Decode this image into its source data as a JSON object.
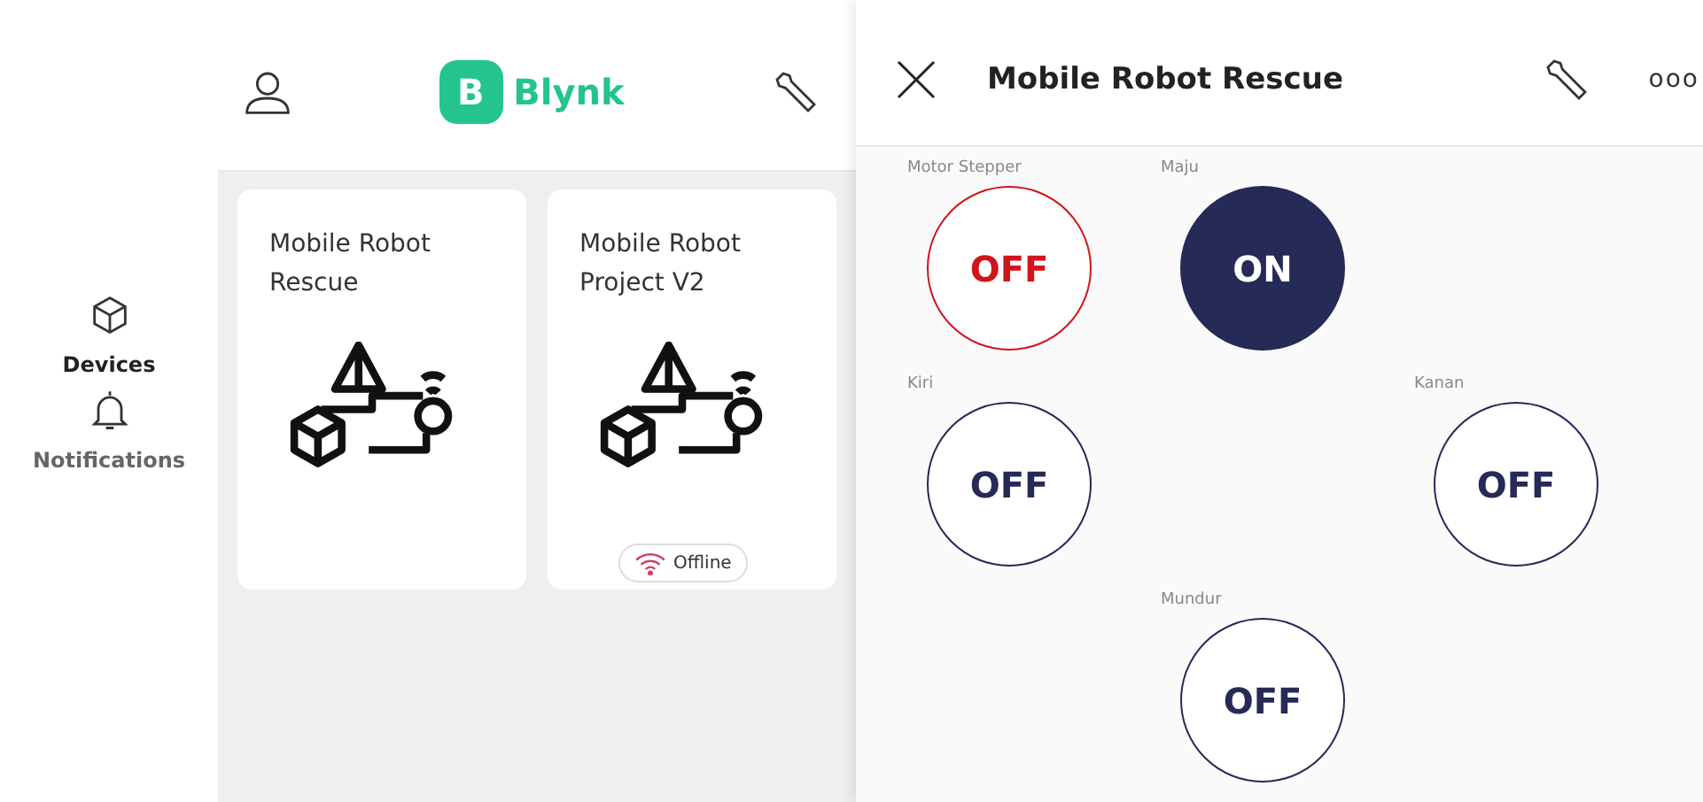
{
  "sidebar": {
    "items": [
      {
        "label": "Devices",
        "selected": true
      },
      {
        "label": "Notifications",
        "selected": false
      }
    ]
  },
  "main": {
    "logo": {
      "mark": "B",
      "name": "Blynk"
    },
    "devices": [
      {
        "name": "Mobile Robot Rescue"
      },
      {
        "name": "Mobile Robot Project V2",
        "status": "Offline"
      }
    ]
  },
  "detail": {
    "title": "Mobile Robot Rescue",
    "more": "ooo",
    "widgets": [
      {
        "label": "Motor Stepper",
        "value": "OFF",
        "on": false,
        "color": "#d0141b"
      },
      {
        "label": "Maju",
        "value": "ON",
        "on": true,
        "color": "#262a57"
      },
      {
        "label": "Kiri",
        "value": "OFF",
        "on": false,
        "color": "#262a57"
      },
      {
        "label": "Kanan",
        "value": "OFF",
        "on": false,
        "color": "#262a57"
      },
      {
        "label": "Mundur",
        "value": "OFF",
        "on": false,
        "color": "#262a57"
      }
    ]
  }
}
